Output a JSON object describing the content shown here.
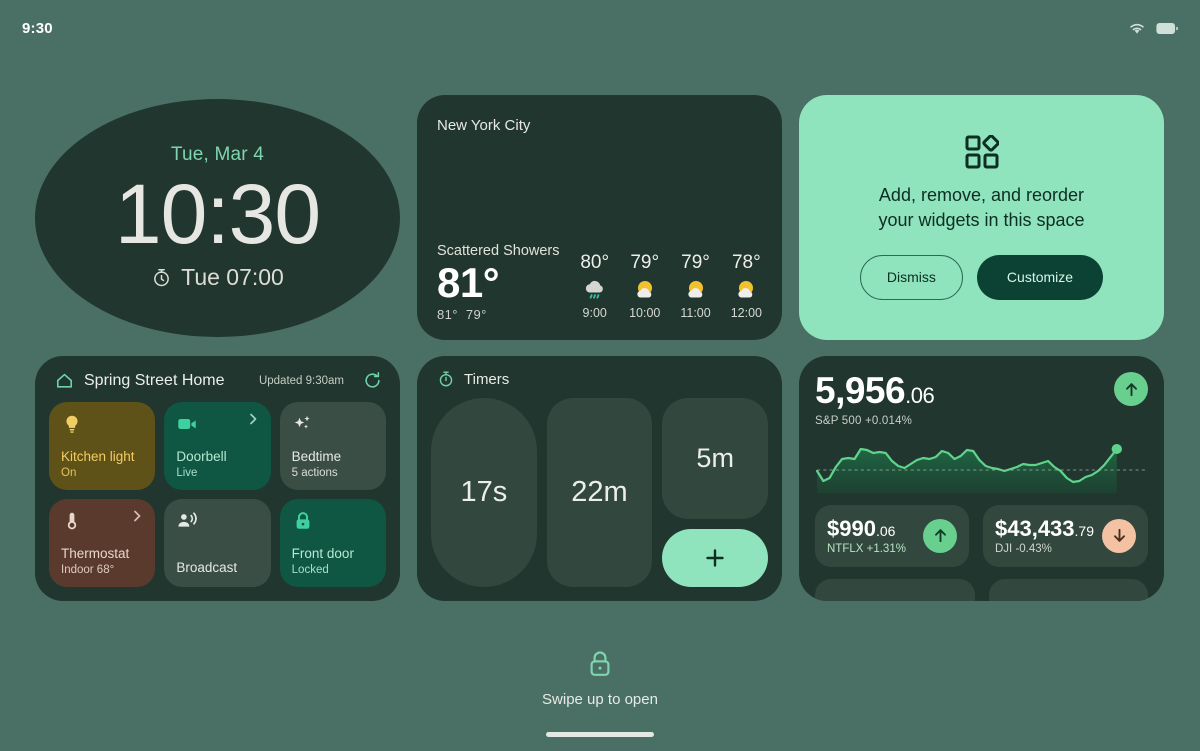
{
  "statusbar": {
    "clock": "9:30",
    "wifi_icon": "wifi-icon",
    "battery_icon": "battery-icon"
  },
  "clock_widget": {
    "date": "Tue, Mar 4",
    "time": "10:30",
    "alarm": "Tue 07:00",
    "alarm_icon": "alarm-clock-icon"
  },
  "weather_widget": {
    "city": "New York City",
    "condition": "Scattered Showers",
    "temperature": "81°",
    "high": "81°",
    "low": "79°",
    "hourly": [
      {
        "temp": "80°",
        "time": "9:00",
        "icon": "rain-cloud-icon"
      },
      {
        "temp": "79°",
        "time": "10:00",
        "icon": "sun-behind-cloud-icon"
      },
      {
        "temp": "79°",
        "time": "11:00",
        "icon": "sun-behind-cloud-icon"
      },
      {
        "temp": "78°",
        "time": "12:00",
        "icon": "sun-behind-cloud-icon"
      }
    ]
  },
  "customize_widget": {
    "icon": "widgets-grid-icon",
    "message_line1": "Add, remove, and reorder",
    "message_line2": "your widgets in this space",
    "dismiss_label": "Dismiss",
    "customize_label": "Customize",
    "background_color": "#8fe3bd",
    "primary_color": "#0b4233"
  },
  "home_widget": {
    "home_icon": "house-icon",
    "title": "Spring Street Home",
    "updated": "Updated 9:30am",
    "refresh_icon": "refresh-icon",
    "tiles": [
      {
        "name": "Kitchen light",
        "status": "On",
        "icon": "lightbulb-icon",
        "chevron": false,
        "color": "#5e5219"
      },
      {
        "name": "Doorbell",
        "status": "Live",
        "icon": "video-cam-icon",
        "chevron": true,
        "color": "#0f5743"
      },
      {
        "name": "Bedtime",
        "status": "5 actions",
        "icon": "sparkles-icon",
        "chevron": false,
        "color": "#3a4e46"
      },
      {
        "name": "Thermostat",
        "status": "Indoor 68°",
        "icon": "thermometer-icon",
        "chevron": true,
        "color": "#5b3a2e"
      },
      {
        "name": "Broadcast",
        "status": "",
        "icon": "broadcast-icon",
        "chevron": false,
        "color": "#3a4e46"
      },
      {
        "name": "Front door",
        "status": "Locked",
        "icon": "lock-icon",
        "chevron": false,
        "color": "#0f5743"
      }
    ]
  },
  "timers_widget": {
    "icon": "timer-icon",
    "title": "Timers",
    "timers": [
      "17s",
      "22m",
      "5m"
    ],
    "add_icon": "plus-icon"
  },
  "stocks_widget": {
    "main": {
      "price_whole": "5,956",
      "price_decimal": ".06",
      "label": "S&P 500 +0.014%",
      "direction_icon": "arrow-up-icon",
      "direction": "up"
    },
    "tiles": [
      {
        "price_whole": "$990",
        "price_decimal": ".06",
        "label": "NTFLX +1.31%",
        "direction": "up",
        "direction_icon": "arrow-up-icon"
      },
      {
        "price_whole": "$43,433",
        "price_decimal": ".79",
        "label": "DJI -0.43%",
        "direction": "down",
        "direction_icon": "arrow-down-icon"
      }
    ]
  },
  "chart_data": {
    "type": "line",
    "title": "S&P 500 intraday sparkline",
    "xlabel": "",
    "ylabel": "",
    "grid": false,
    "legend": "none",
    "baseline": 0,
    "line_color": "#5fd38c",
    "fill_color": "#1d5a3d",
    "marker": {
      "x": 96,
      "y": 15,
      "color": "#5fd38c"
    },
    "x": [
      0,
      2,
      4,
      6,
      8,
      10,
      12,
      14,
      16,
      18,
      20,
      22,
      24,
      26,
      28,
      30,
      32,
      34,
      36,
      38,
      40,
      42,
      44,
      46,
      48,
      50,
      52,
      54,
      56,
      58,
      60,
      62,
      64,
      66,
      68,
      70,
      72,
      74,
      76,
      78,
      80,
      82,
      84,
      86,
      88,
      90,
      92,
      94,
      96
    ],
    "values": [
      -2,
      -6,
      -5,
      2,
      6,
      7,
      6,
      14,
      13,
      11,
      12,
      11,
      5,
      2,
      0,
      3,
      6,
      7,
      6,
      8,
      12,
      11,
      7,
      9,
      13,
      12,
      6,
      2,
      0,
      -1,
      -2,
      -1,
      1,
      3,
      2,
      2,
      4,
      5,
      1,
      -2,
      -6,
      -9,
      -8,
      -5,
      -4,
      -1,
      3,
      9,
      15
    ]
  },
  "bottom": {
    "lock_icon": "lock-icon",
    "swipe_text": "Swipe up to open",
    "home_bar": "home-indicator"
  }
}
